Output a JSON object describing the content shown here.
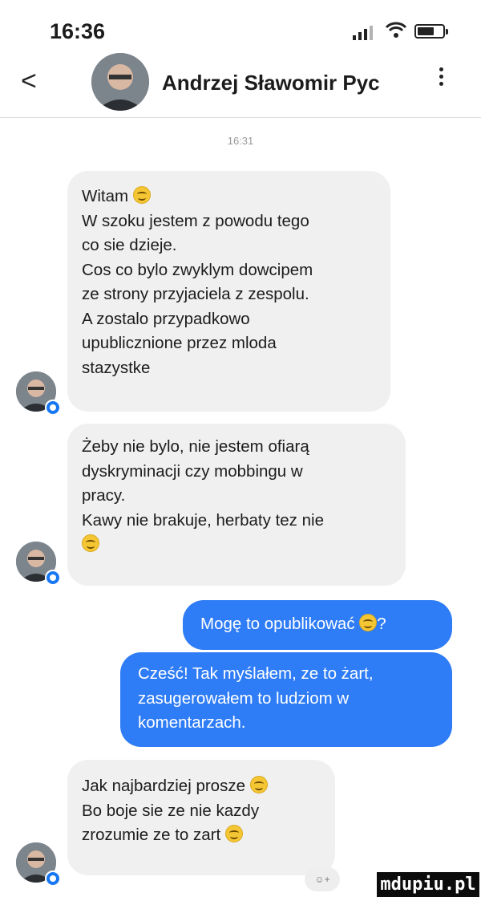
{
  "status_bar": {
    "time": "16:36",
    "icons": [
      "signal-icon",
      "wifi-icon",
      "battery-icon"
    ]
  },
  "header": {
    "back_icon": "chevron-left-icon",
    "contact_name": "Andrzej Sławomir Pyc",
    "more_icon": "more-vertical-icon"
  },
  "conversation": {
    "timestamp": "16:31",
    "messages": [
      {
        "direction": "incoming",
        "lines": [
          "Witam",
          "W szoku jestem z powodu tego",
          "co sie dzieje.",
          "Cos co bylo zwyklym dowcipem",
          "ze strony przyjaciela z zespolu.",
          "A zostalo przypadkowo",
          "upublicznione przez mloda",
          "stazystke"
        ],
        "emoji_after_line": [
          0
        ]
      },
      {
        "direction": "incoming",
        "lines": [
          "Żeby nie bylo, nie jestem ofiarą",
          "dyskryminacji czy mobbingu w",
          "pracy.",
          "Kawy nie brakuje, herbaty tez nie",
          ""
        ],
        "emoji_after_line": [
          4
        ]
      },
      {
        "direction": "outgoing",
        "lines": [
          "Mogę to opublikować",
          "?"
        ],
        "emoji_after_line": [
          0
        ]
      },
      {
        "direction": "outgoing",
        "lines": [
          "Cześć! Tak myślałem, ze to żart,",
          "zasugerowałem to ludziom w",
          "komentarzach."
        ],
        "emoji_after_line": []
      },
      {
        "direction": "incoming",
        "lines": [
          "Jak najbardziej prosze",
          "Bo boje sie ze nie kazdy",
          "zrozumie ze to zart"
        ],
        "emoji_after_line": [
          0,
          2
        ]
      }
    ]
  },
  "colors": {
    "incoming_bubble": "#f0f0f0",
    "outgoing_bubble": "#2e7cf6",
    "text": "#1c1c1c"
  },
  "reaction_button": {
    "label": "☺+"
  },
  "watermark": "mdupiu.pl"
}
